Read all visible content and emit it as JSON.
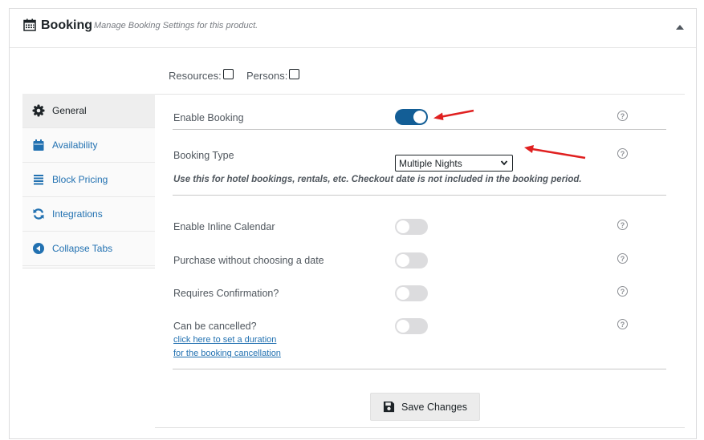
{
  "header": {
    "title": "Booking",
    "subtitle": "Manage Booking Settings for this product."
  },
  "options": {
    "resources_label": "Resources:",
    "persons_label": "Persons:"
  },
  "sidebar": {
    "items": [
      {
        "label": "General",
        "icon": "gear-icon",
        "active": true
      },
      {
        "label": "Availability",
        "icon": "calendar-icon"
      },
      {
        "label": "Block Pricing",
        "icon": "list-icon"
      },
      {
        "label": "Integrations",
        "icon": "sync-icon"
      },
      {
        "label": "Collapse Tabs",
        "icon": "arrow-left-circle-icon"
      }
    ]
  },
  "general": {
    "enable_booking": {
      "label": "Enable Booking",
      "on": true
    },
    "booking_type": {
      "label": "Booking Type",
      "value": "Multiple Nights",
      "note": "Use this for hotel bookings, rentals, etc. Checkout date is not included in the booking period."
    },
    "enable_inline_calendar": {
      "label": "Enable Inline Calendar",
      "on": false
    },
    "purchase_without_date": {
      "label": "Purchase without choosing a date",
      "on": false
    },
    "requires_confirmation": {
      "label": "Requires Confirmation?",
      "on": false
    },
    "can_be_cancelled": {
      "label": "Can be cancelled?",
      "on": false,
      "link_line1": "click here to set a duration",
      "link_line2": "for the booking cancellation"
    }
  },
  "help_glyph": "?",
  "save_button": {
    "label": "Save Changes"
  },
  "colors": {
    "accent": "#2271b1",
    "toggle_on": "#135e96",
    "arrow": "#e02020"
  }
}
